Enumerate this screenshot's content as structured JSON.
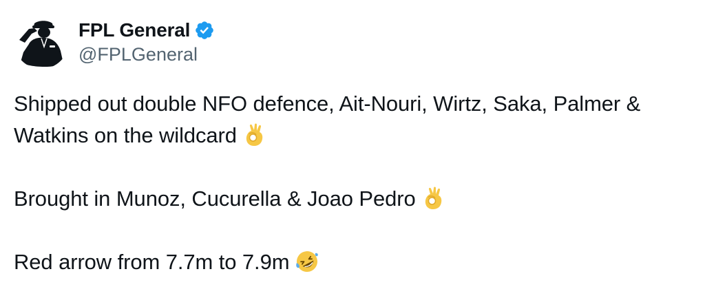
{
  "author": {
    "display_name": "FPL General",
    "handle": "@FPLGeneral",
    "avatar_icon": "saluting-soldier-avatar-icon",
    "verified_icon": "verified-badge-icon",
    "verified_color": "#1d9bf0"
  },
  "tweet": {
    "line1": "Shipped out double NFO defence, Ait-Nouri, Wirtz, Saka, Palmer &",
    "line2": "Watkins on the wildcard",
    "line3": "Brought in Munoz, Cucurella & Joao Pedro",
    "line4": "Red arrow from 7.7m to 7.9m",
    "emoji1": "ok-hand-emoji-icon",
    "emoji2": "ok-hand-emoji-icon",
    "emoji3": "rolling-on-floor-laughing-emoji-icon"
  },
  "colors": {
    "text": "#0f1419",
    "secondary": "#536471",
    "emoji_yellow": "#f6c745"
  }
}
